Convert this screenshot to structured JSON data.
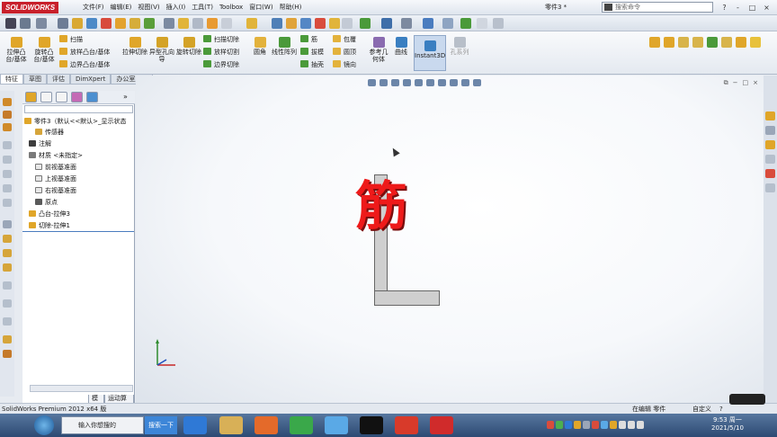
{
  "app": {
    "logo": "SOLIDWORKS",
    "doc_title": "零件3 *"
  },
  "menu": [
    "文件(F)",
    "编辑(E)",
    "视图(V)",
    "插入(I)",
    "工具(T)",
    "Toolbox",
    "窗口(W)",
    "帮助(H)"
  ],
  "search": {
    "placeholder": "搜索命令"
  },
  "window_controls": [
    "?",
    "-",
    "□",
    "×"
  ],
  "ribbon": {
    "big": [
      {
        "label": "拉伸凸台/基体",
        "icon": "extrude-boss-icon",
        "color": "#e0a629"
      },
      {
        "label": "旋转凸台/基体",
        "icon": "revolve-boss-icon",
        "color": "#e0a629"
      },
      {
        "label": "拉伸切除",
        "icon": "extrude-cut-icon",
        "color": "#e0a629"
      },
      {
        "label": "异型孔向导",
        "icon": "hole-wizard-icon",
        "color": "#d4a327"
      },
      {
        "label": "旋转切除",
        "icon": "revolve-cut-icon",
        "color": "#d4a327"
      },
      {
        "label": "圆角",
        "icon": "fillet-icon",
        "color": "#e3b23c"
      },
      {
        "label": "线性阵列",
        "icon": "linear-pattern-icon",
        "color": "#4b9a3a"
      },
      {
        "label": "参考几何体",
        "icon": "reference-geometry-icon",
        "color": "#8a6bb0"
      },
      {
        "label": "曲线",
        "icon": "curves-icon",
        "color": "#3a7fc1"
      },
      {
        "label": "孔系列",
        "icon": "hole-series-icon",
        "color": "#b8bfc9"
      }
    ],
    "small": [
      {
        "label": "扫描",
        "icon": "sweep-icon"
      },
      {
        "label": "放样凸台/基体",
        "icon": "loft-icon"
      },
      {
        "label": "边界凸台/基体",
        "icon": "boundary-boss-icon"
      },
      {
        "label": "扫描切除",
        "icon": "swept-cut-icon"
      },
      {
        "label": "放样切割",
        "icon": "lofted-cut-icon"
      },
      {
        "label": "边界切除",
        "icon": "boundary-cut-icon"
      },
      {
        "label": "筋",
        "icon": "rib-icon"
      },
      {
        "label": "拔模",
        "icon": "draft-icon"
      },
      {
        "label": "抽壳",
        "icon": "shell-icon"
      },
      {
        "label": "包覆",
        "icon": "wrap-icon"
      },
      {
        "label": "圆顶",
        "icon": "dome-icon"
      },
      {
        "label": "镜向",
        "icon": "mirror-icon"
      }
    ],
    "instant3d": "Instant3D"
  },
  "tabs": [
    "特征",
    "草图",
    "评估",
    "DimXpert",
    "办公室产品"
  ],
  "tree": {
    "root": "零件3（默认<<默认>_显示状态",
    "nodes": [
      "传感器",
      "注解",
      "材质 <未指定>",
      "前视基准面",
      "上视基准面",
      "右视基准面",
      "原点",
      "凸台-拉伸3",
      "切除-拉伸1"
    ]
  },
  "model_tabs": [
    "模型",
    "运动算例 1"
  ],
  "canvas": {
    "big_char": "筋"
  },
  "status": {
    "left": "SolidWorks Premium 2012 x64 版",
    "mode": "在编辑 零件",
    "custom": "自定义",
    "help": "?"
  },
  "taskbar": {
    "search_placeholder": "输入你想搜的",
    "search_button": "搜索一下",
    "time": "9:53 周一",
    "date": "2021/5/10"
  }
}
